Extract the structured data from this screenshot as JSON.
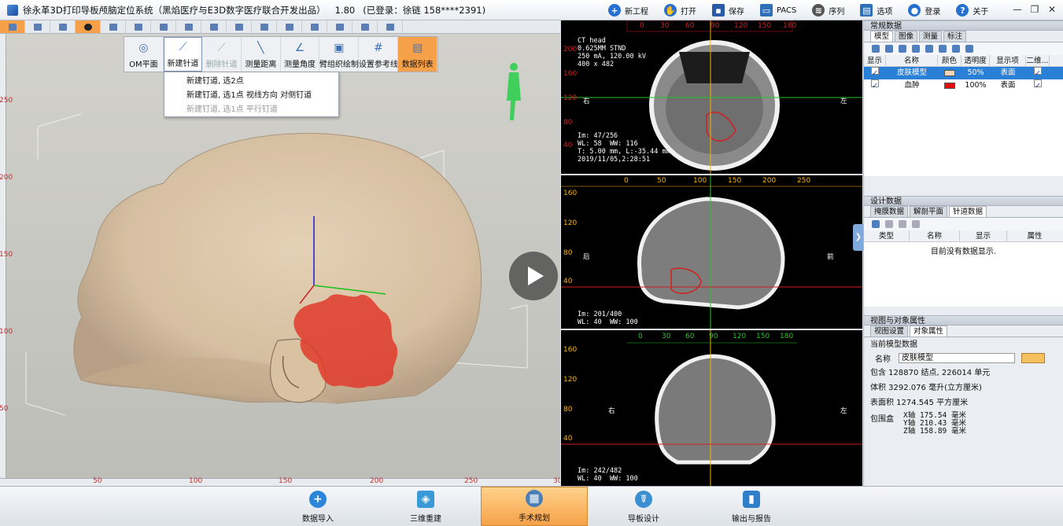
{
  "titlebar": {
    "title": "徐永革3D打印导板颅脑定位系统（黑焰医疗与E3D数字医疗联合开发出品）",
    "version": "1.80",
    "login": "(已登录：徐链 158****2391)",
    "tools": [
      {
        "label": "新工程",
        "icon": "plus-circle-icon",
        "color": "#2670d0"
      },
      {
        "label": "打开",
        "icon": "hand-icon",
        "color": "#2670d0"
      },
      {
        "label": "保存",
        "icon": "floppy-icon",
        "color": "#2a5aa5"
      },
      {
        "label": "PACS",
        "icon": "monitor-icon",
        "color": "#2f6fb8"
      },
      {
        "label": "序列",
        "icon": "layers-icon",
        "color": "#555555"
      },
      {
        "label": "选项",
        "icon": "options-icon",
        "color": "#2f6fb8"
      },
      {
        "label": "登录",
        "icon": "user-icon",
        "color": "#2670d0"
      },
      {
        "label": "关于",
        "icon": "question-icon",
        "color": "#2670d0"
      }
    ]
  },
  "view3d": {
    "tool_panel": [
      "OM平面",
      "新建针道",
      "删除针道",
      "测量距离",
      "测量角度",
      "臂组织绘制",
      "设置参考线",
      "数据列表"
    ],
    "dropdown": [
      "新建钉道, 选2点",
      "新建钉道, 选1点 视线方向 对侧钉道",
      "新建钉道, 选1点 平行钉道"
    ],
    "ruler_left": [
      "250",
      "200",
      "150",
      "100",
      "50"
    ],
    "ruler_bottom": [
      "50",
      "100",
      "150",
      "200",
      "250",
      "30"
    ]
  },
  "axial": {
    "info": "CT head\n0.625MM STND\n250 mA, 120.00 kV\n400 x 482",
    "footer": "Im: 47/256\nWL: 58  WW: 116\nT: 5.00 mm, L:-35.44 mm\n2019/11/05,2:28:51",
    "scale_top": [
      "0",
      "30",
      "60",
      "90",
      "120",
      "150",
      "180"
    ],
    "scale_left": [
      "200",
      "160",
      "120",
      "80",
      "40"
    ],
    "left_label": "右",
    "right_label": "左"
  },
  "sagittal": {
    "footer": "Im: 201/400\nWL: 40  WW: 100",
    "scale_top": [
      "0",
      "50",
      "100",
      "150",
      "200",
      "250"
    ],
    "scale_left": [
      "160",
      "120",
      "80",
      "40"
    ],
    "left_label": "后",
    "right_label": "前"
  },
  "coronal": {
    "footer": "Im: 242/482\nWL: 40  WW: 100",
    "scale_top": [
      "0",
      "30",
      "60",
      "90",
      "120",
      "150",
      "180"
    ],
    "scale_left": [
      "160",
      "120",
      "80",
      "40"
    ],
    "left_label": "右",
    "right_label": "左"
  },
  "panel_data": {
    "header": "常规数据",
    "tabs": [
      "模型",
      "图像",
      "测量",
      "标注"
    ],
    "columns": [
      "显示",
      "名称",
      "颜色",
      "透明度",
      "显示项",
      "二维..."
    ],
    "rows": [
      {
        "name": "皮肤模型",
        "color": "#f5d6b8",
        "opacity": "50%",
        "mode": "表面"
      },
      {
        "name": "血肿",
        "color": "#e01010",
        "opacity": "100%",
        "mode": "表面"
      }
    ]
  },
  "panel_design": {
    "header": "设计数据",
    "tabs": [
      "掩膜数据",
      "解剖平面",
      "针道数据"
    ],
    "columns": [
      "类型",
      "名称",
      "显示",
      "属性"
    ],
    "empty": "目前没有数据显示."
  },
  "panel_props": {
    "header": "视图与对象属性",
    "tabs": [
      "视图设置",
      "对象属性"
    ],
    "section": "当前模型数据",
    "name_label": "名称",
    "name_value": "皮肤模型",
    "contains": "包含 128870 结点, 226014 单元",
    "volume": "体积 3292.076 毫升(立方厘米)",
    "area": "表面积 1274.545 平方厘米",
    "bbox_label": "包围盒",
    "bbox_x": "X轴 175.54 毫米",
    "bbox_y": "Y轴 210.43 毫米",
    "bbox_z": "Z轴 158.89 毫米"
  },
  "taskbar": [
    {
      "label": "数据导入",
      "icon": "plus-icon",
      "color": "#2b86d9"
    },
    {
      "label": "三维重建",
      "icon": "cube-icon",
      "color": "#3a9ad8"
    },
    {
      "label": "手术规划",
      "icon": "plan-icon",
      "color": "#4b7fb6"
    },
    {
      "label": "导板设计",
      "icon": "guide-icon",
      "color": "#3b8fd0"
    },
    {
      "label": "输出与报告",
      "icon": "report-icon",
      "color": "#2f7fca"
    }
  ]
}
